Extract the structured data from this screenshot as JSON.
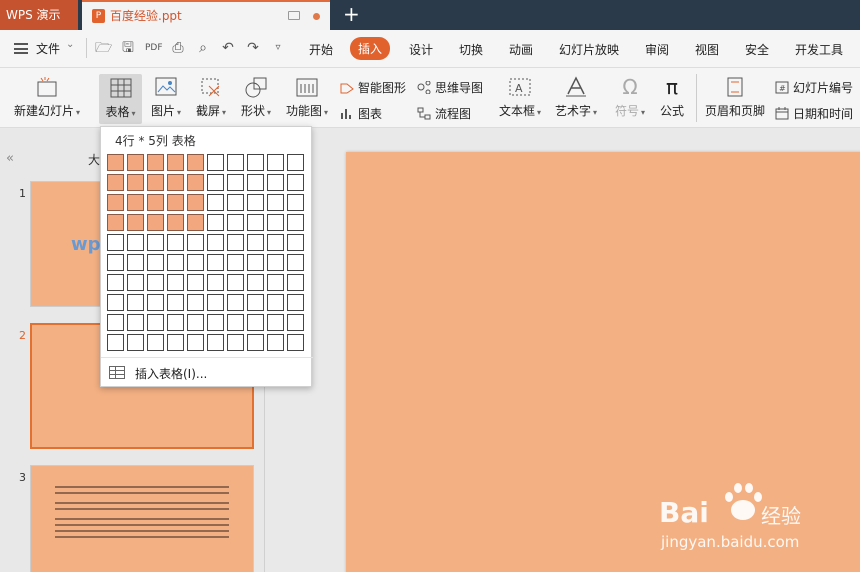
{
  "titlebar": {
    "app_tab": "WPS 演示",
    "doc_tab": "百度经验.ppt",
    "new_tab": "+"
  },
  "menubar": {
    "file": "文件",
    "items": [
      "开始",
      "插入",
      "设计",
      "切换",
      "动画",
      "幻灯片放映",
      "审阅",
      "视图",
      "安全",
      "开发工具"
    ],
    "active": "插入"
  },
  "ribbon": {
    "new_slide": "新建幻灯片",
    "table": "表格",
    "picture": "图片",
    "screenshot": "截屏",
    "shape": "形状",
    "func_chart": "功能图",
    "smart_graphic": "智能图形",
    "chart": "图表",
    "mind_map": "思维导图",
    "flowchart": "流程图",
    "textbox": "文本框",
    "wordart": "艺术字",
    "symbol": "符号",
    "formula": "公式",
    "header_footer": "页眉和页脚",
    "slide_number": "幻灯片编号",
    "date_time": "日期和时间"
  },
  "table_dropdown": {
    "title": "4行 * 5列 表格",
    "rows": 10,
    "cols": 10,
    "selected_rows": 4,
    "selected_cols": 5,
    "insert_label": "插入表格(I)..."
  },
  "left_panel": {
    "collapse_icon": "«",
    "header": "大",
    "slides": [
      {
        "num": "1",
        "label": "wps"
      },
      {
        "num": "2",
        "label": ""
      },
      {
        "num": "3",
        "label": ""
      }
    ]
  },
  "colors": {
    "accent": "#e2622d",
    "slide_fill": "#f3b083",
    "grid_selected": "#f3a77e",
    "titlebar": "#2b3a4a"
  },
  "watermark": {
    "brand_a": "Bai",
    "brand_b": "经验",
    "url": "jingyan.baidu.com"
  }
}
